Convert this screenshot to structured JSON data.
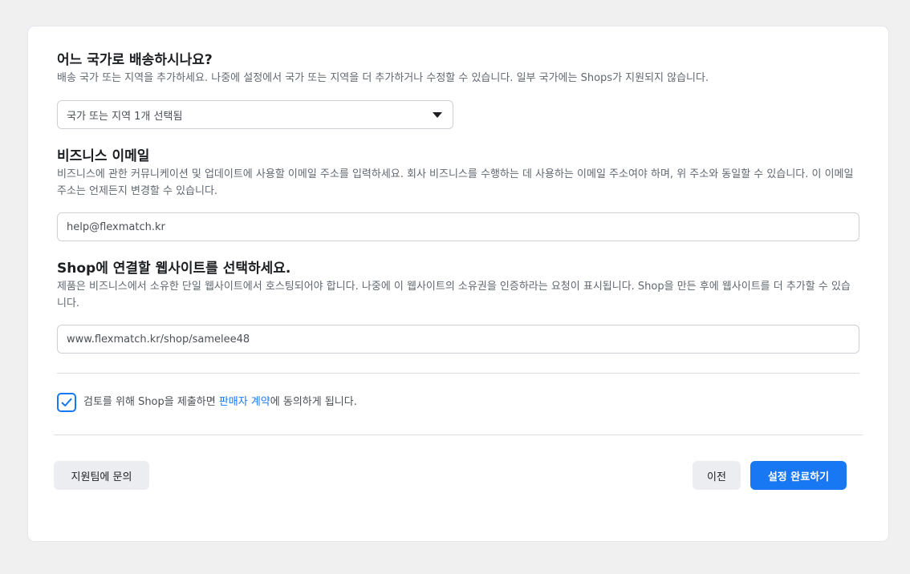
{
  "shipping": {
    "heading": "어느 국가로 배송하시나요?",
    "description": "배송 국가 또는 지역을 추가하세요. 나중에 설정에서 국가 또는 지역을 더 추가하거나 수정할 수 있습니다. 일부 국가에는 Shops가 지원되지 않습니다.",
    "select_value": "국가 또는 지역 1개 선택됨"
  },
  "email": {
    "heading": "비즈니스 이메일",
    "description": "비즈니스에 관한 커뮤니케이션 및 업데이트에 사용할 이메일 주소를 입력하세요. 회사 비즈니스를 수행하는 데 사용하는 이메일 주소여야 하며, 위 주소와 동일할 수 있습니다. 이 이메일 주소는 언제든지 변경할 수 있습니다.",
    "value": "help@flexmatch.kr"
  },
  "website": {
    "heading": "Shop에 연결할 웹사이트를 선택하세요.",
    "description": "제품은 비즈니스에서 소유한 단일 웹사이트에서 호스팅되어야 합니다. 나중에 이 웹사이트의 소유권을 인증하라는 요청이 표시됩니다. Shop을 만든 후에 웹사이트를 더 추가할 수 있습니다.",
    "value": "www.flexmatch.kr/shop/samelee48"
  },
  "agreement": {
    "checked": true,
    "text_before": "검토를 위해 Shop을 제출하면 ",
    "link_text": "판매자 계약",
    "text_after": "에 동의하게 됩니다."
  },
  "footer": {
    "support_label": "지원팀에 문의",
    "back_label": "이전",
    "finish_label": "설정 완료하기"
  },
  "colors": {
    "accent": "#1877f2",
    "background": "#f0f0f1"
  },
  "icons": {
    "select_caret": "caret-down-icon",
    "checkbox": "checkmark-icon"
  }
}
